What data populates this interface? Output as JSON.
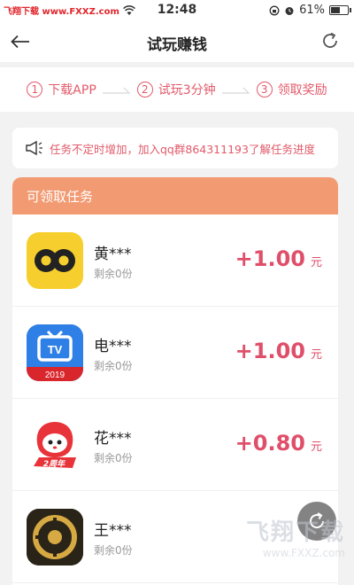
{
  "status_bar": {
    "watermark": "飞翔下载 www.FXXZ.com",
    "time": "12:48",
    "battery_percent": "61%",
    "battery_level": 0.61
  },
  "nav": {
    "title": "试玩赚钱",
    "back_icon": "back-arrow-icon",
    "refresh_icon": "refresh-icon"
  },
  "steps": [
    {
      "num": "1",
      "label": "下载APP"
    },
    {
      "num": "2",
      "label": "试玩3分钟"
    },
    {
      "num": "3",
      "label": "领取奖励"
    }
  ],
  "notice": {
    "icon": "megaphone-icon",
    "text": "任务不定时增加，加入qq群864311193了解任务进度"
  },
  "panel": {
    "header": "可领取任务",
    "header_color": "#f29a72"
  },
  "tasks": [
    {
      "name": "黄***",
      "remain": "剩余0份",
      "amount": "+1.00",
      "unit": "元",
      "icon": "yellow-app-icon"
    },
    {
      "name": "电***",
      "remain": "剩余0份",
      "amount": "+1.00",
      "unit": "元",
      "icon": "tv-app-icon",
      "badge": "2019"
    },
    {
      "name": "花***",
      "remain": "剩余0份",
      "amount": "+0.80",
      "unit": "元",
      "icon": "huajiao-app-icon",
      "badge": "2周年"
    },
    {
      "name": "王***",
      "remain": "剩余0份",
      "amount": "",
      "unit": "",
      "icon": "game-app-icon"
    }
  ],
  "watermark_br": {
    "title": "飞翔下载",
    "url": "www.FXXZ.com"
  },
  "colors": {
    "accent": "#e04f6a",
    "step": "#e25a6a",
    "header": "#f29a72"
  }
}
